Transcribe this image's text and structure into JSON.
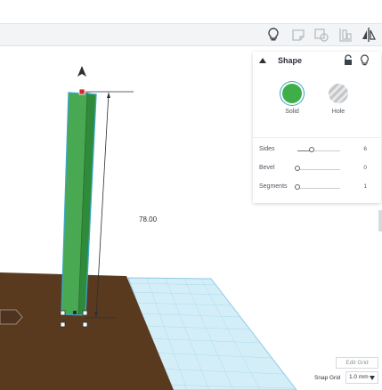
{
  "toolbar": {
    "buttons": [
      {
        "name": "lightbulb-icon"
      },
      {
        "name": "note-icon"
      },
      {
        "name": "shape-note-icon"
      },
      {
        "name": "align-icon"
      },
      {
        "name": "mirror-icon"
      }
    ]
  },
  "shape_panel": {
    "title": "Shape",
    "solid_label": "Solid",
    "hole_label": "Hole",
    "solid_color": "#3fae49",
    "properties": {
      "sides": {
        "label": "Sides",
        "value": "6",
        "fraction": 0.33
      },
      "bevel": {
        "label": "Bevel",
        "value": "0",
        "fraction": 0.0
      },
      "segments": {
        "label": "Segments",
        "value": "1",
        "fraction": 0.0
      }
    }
  },
  "workplane": {
    "dimension_value": "78.00",
    "shape_color": "#3fae49",
    "selection_color": "#39a6c8",
    "ground_color": "#5a3a1f",
    "grid_color": "#bde3f2"
  },
  "grid_controls": {
    "edit_grid_label": "Edit Grid",
    "snap_grid_label": "Snap Grid",
    "snap_grid_value": "1.0 mm"
  }
}
